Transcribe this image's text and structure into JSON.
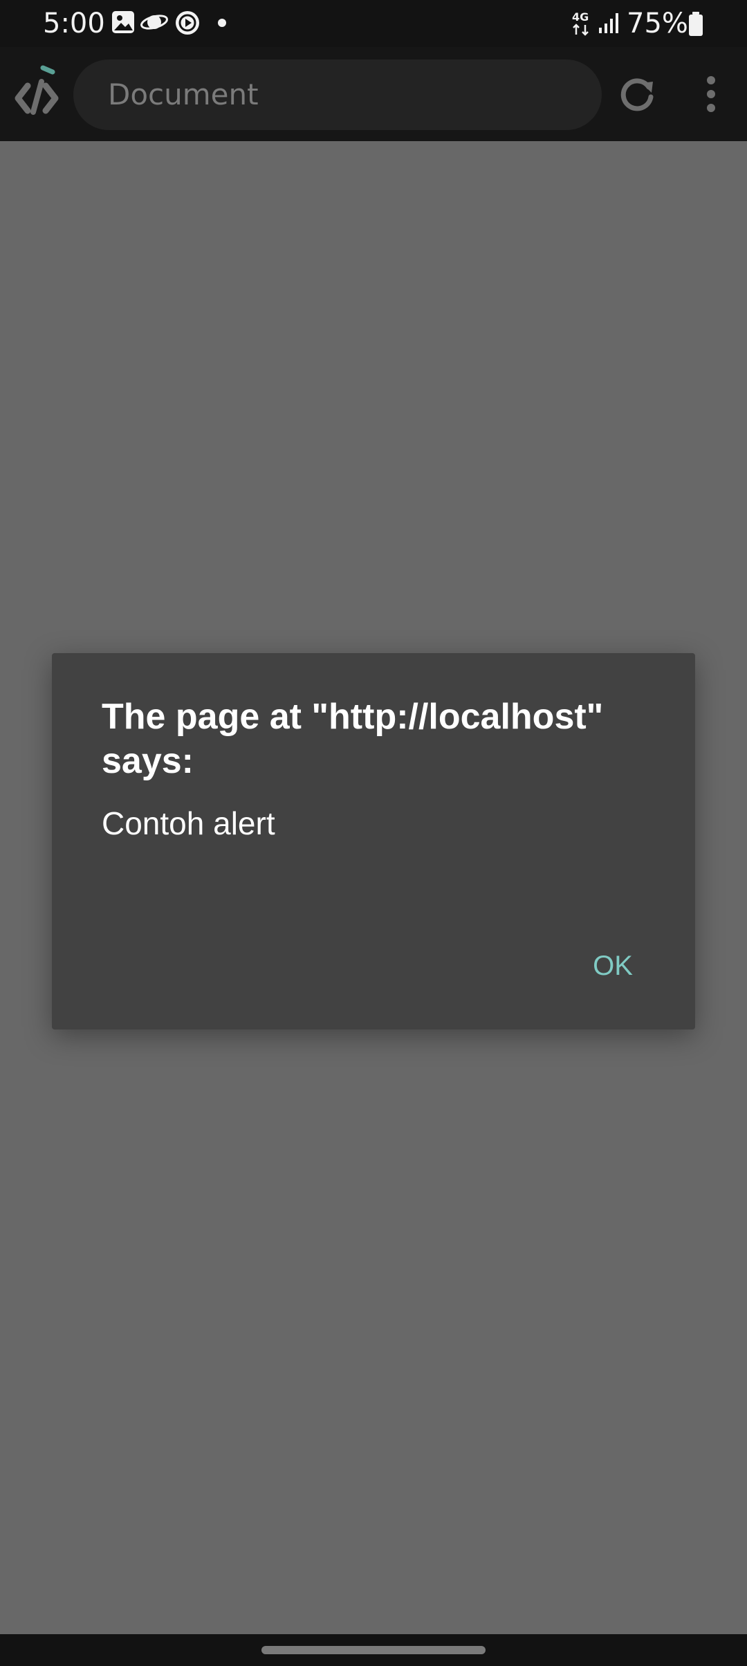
{
  "status_bar": {
    "time": "5:00",
    "battery": "75%",
    "network": "4G",
    "icons": [
      "gallery-icon",
      "saturn-icon",
      "play-circle-icon",
      "notification-dot-icon",
      "network-4g-icon",
      "signal-icon",
      "battery-icon"
    ]
  },
  "toolbar": {
    "url_title": "Document",
    "icons": [
      "app-logo-icon",
      "reload-icon",
      "more-vert-icon"
    ],
    "accent_color": "#5aa095"
  },
  "dialog": {
    "title": "The page at \"http://localhost\" says:",
    "message": "Contoh alert",
    "ok_label": "OK",
    "ok_color": "#80cbc4"
  }
}
